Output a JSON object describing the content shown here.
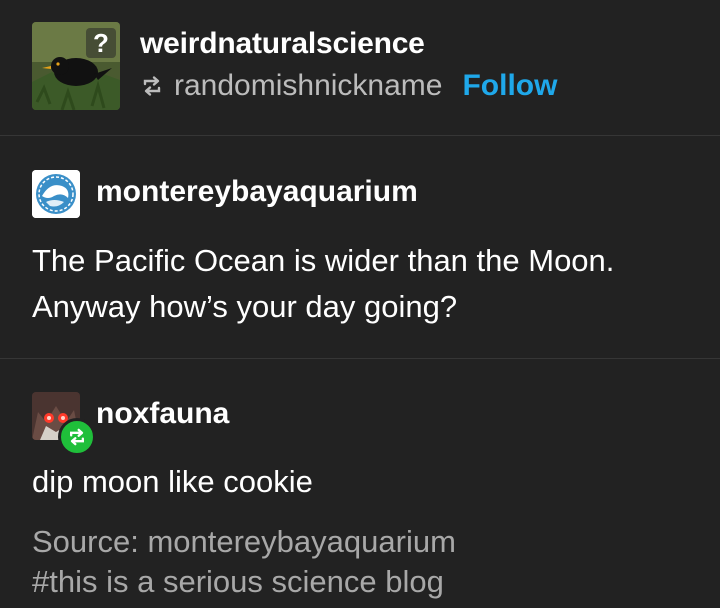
{
  "header": {
    "blog_name": "weirdnaturalscience",
    "reblogged_from": "randomishnickname",
    "follow_label": "Follow",
    "avatar_icon": "blackbird-avatar",
    "reblog_icon": "reblog-icon"
  },
  "post1": {
    "author": "montereybayaquarium",
    "avatar_icon": "aquarium-logo-avatar",
    "body_lines": [
      "The Pacific Ocean is wider than the Moon.",
      "Anyway how’s your day going?"
    ]
  },
  "post2": {
    "author": "noxfauna",
    "avatar_icon": "glowing-eyes-avatar",
    "badge_icon": "reblog-badge-icon",
    "body": "dip moon like cookie",
    "source": "Source: montereybayaquarium",
    "tag": "#this is a serious science blog"
  },
  "colors": {
    "background": "#222222",
    "text": "#ffffff",
    "muted": "#a8a8a8",
    "follow": "#1fa8ea",
    "reblog_badge": "#1fbf3a"
  }
}
